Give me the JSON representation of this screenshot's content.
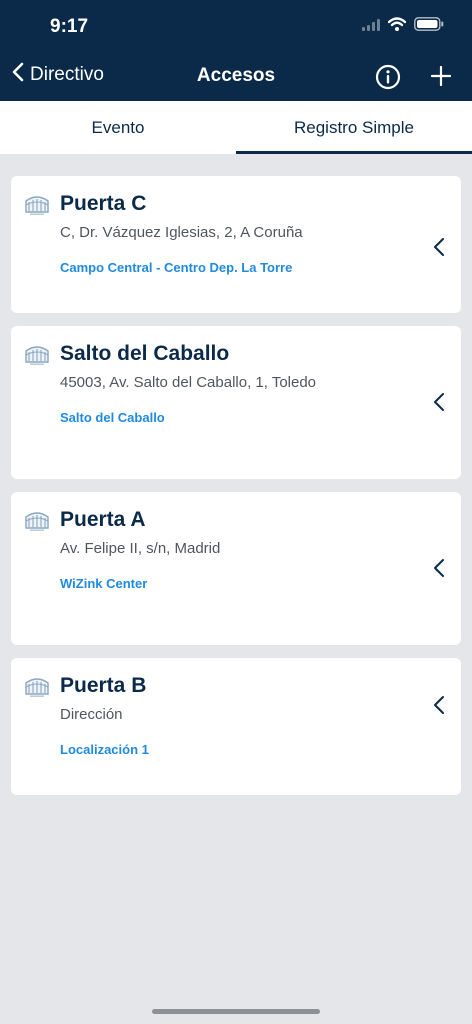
{
  "status_bar": {
    "time": "9:17",
    "icons": [
      "cellular-icon",
      "wifi-icon",
      "battery-icon"
    ]
  },
  "nav": {
    "back_label": "Directivo",
    "title": "Accesos",
    "actions": [
      "info-icon",
      "plus-icon"
    ]
  },
  "tabs": [
    {
      "label": "Evento",
      "active": false
    },
    {
      "label": "Registro Simple",
      "active": true
    }
  ],
  "accesses": [
    {
      "title": "Puerta C",
      "address": "C, Dr. Vázquez Iglesias, 2, A Coruña",
      "venue": "Campo Central - Centro Dep. La Torre"
    },
    {
      "title": "Salto del Caballo",
      "address": "45003, Av. Salto del Caballo, 1, Toledo",
      "venue": "Salto del Caballo"
    },
    {
      "title": "Puerta A",
      "address": "Av. Felipe II, s/n, Madrid",
      "venue": "WiZink Center"
    },
    {
      "title": "Puerta B",
      "address": "Dirección",
      "venue": "Localización 1"
    }
  ],
  "colors": {
    "header_bg": "#0b2a4a",
    "page_bg": "#e4e6e9",
    "venue_link": "#1f8ae0",
    "title_text": "#0b2a4a"
  }
}
